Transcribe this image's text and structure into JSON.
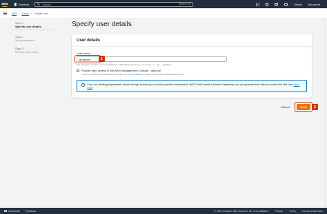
{
  "topnav": {
    "logo_text": "aws",
    "services_label": "Services",
    "search_placeholder": "Search",
    "search_hint": "[Option+S]",
    "region": "Global",
    "account": "My server"
  },
  "breadcrumb": [
    "IAM",
    "Users",
    "Create user"
  ],
  "steps": [
    {
      "num": "Step 1",
      "title": "Specify user details",
      "active": true
    },
    {
      "num": "Step 2",
      "title": "Set permissions",
      "active": false
    },
    {
      "num": "Step 3",
      "title": "Review and create",
      "active": false
    }
  ],
  "page_title": "Specify user details",
  "card": {
    "header": "User details",
    "user_name_label": "User name",
    "user_name_value": "terraform",
    "user_name_constraint": "The user name can have up to 64 characters. Valid characters: A-Z, a-z, 0-9, and + = , . @ _ - (hyphen)",
    "console_access_label": "Provide user access to the AWS Management Console - optional",
    "console_access_desc_prefix": "If you're providing console access to a person, it's a ",
    "console_access_desc_link": "best practice",
    "console_access_desc_suffix": " to manage their access in IAM Identity Center.",
    "info_text": "If you are creating programmatic access through access keys or service-specific credentials for AWS CodeCommit or Amazon Keyspaces, you can generate them after you create this IAM user.",
    "info_link": "Learn more"
  },
  "buttons": {
    "cancel": "Cancel",
    "next": "Next"
  },
  "annotations": {
    "badge1": "1",
    "badge2": "2"
  },
  "footer": {
    "cloudshell": "CloudShell",
    "feedback": "Feedback",
    "copyright": "© 2024, Amazon Web Services, Inc. or its affiliates.",
    "privacy": "Privacy",
    "terms": "Terms",
    "cookie": "Cookie preferences"
  },
  "colors": {
    "nav_bg": "#232f3e",
    "accent_orange": "#ec7211",
    "link_blue": "#0073bb",
    "highlight_red": "#d13212"
  }
}
